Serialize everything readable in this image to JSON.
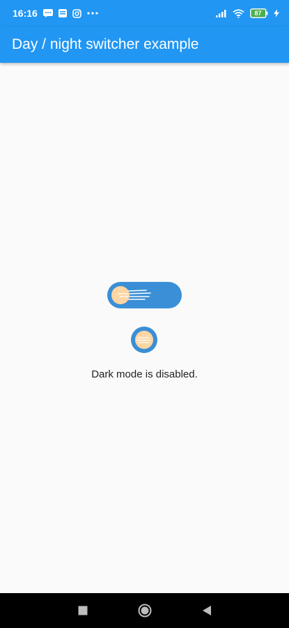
{
  "status_bar": {
    "time": "16:16",
    "battery": "87",
    "icons": [
      "message-icon",
      "news-icon",
      "instagram-icon",
      "more-dots-icon",
      "signal-icon",
      "wifi-icon",
      "battery-icon",
      "charging-icon"
    ]
  },
  "app_bar": {
    "title": "Day / night switcher example"
  },
  "main": {
    "switch_state": "off",
    "status_text": "Dark mode is disabled."
  },
  "nav_bar": {
    "icons": [
      "recent-apps-icon",
      "home-icon",
      "back-icon"
    ]
  },
  "colors": {
    "primary": "#2196f3",
    "switch_track": "#3a8fd6",
    "sun": "#fdd6a3",
    "background": "#fafafa"
  }
}
